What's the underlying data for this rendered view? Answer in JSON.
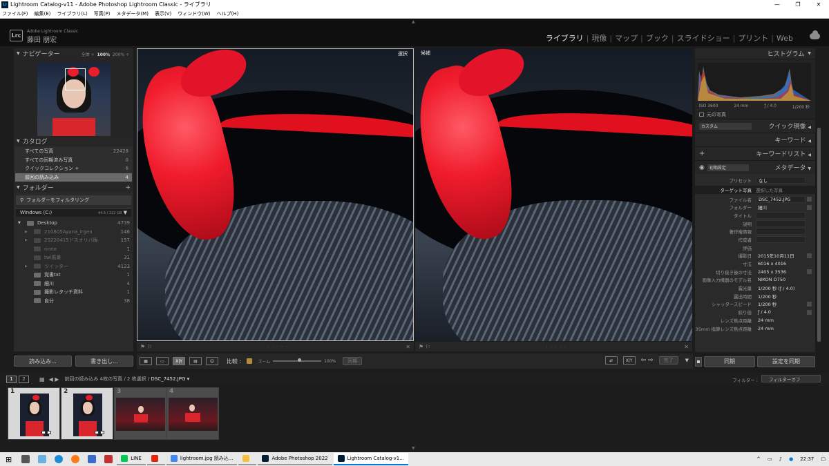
{
  "window": {
    "app_badge": "Lr",
    "title": "Lightroom Catalog-v11 - Adobe Photoshop Lightroom Classic - ライブラリ",
    "controls": [
      "—",
      "❐",
      "✕"
    ]
  },
  "menu": [
    "ファイル(F)",
    "編集(E)",
    "ライブラリ(L)",
    "写真(P)",
    "メタデータ(M)",
    "表示(V)",
    "ウィンドウ(W)",
    "ヘルプ(H)"
  ],
  "identity": {
    "logo": "Lrc",
    "product": "Adobe Lightroom Classic",
    "name": "藤田 朋宏"
  },
  "modules": {
    "items": [
      "ライブラリ",
      "現像",
      "マップ",
      "ブック",
      "スライドショー",
      "プリント",
      "Web"
    ],
    "active": "ライブラリ"
  },
  "navigator": {
    "title": "ナビゲーター",
    "zooms": [
      "全体 ÷",
      "100%",
      "200% ÷"
    ]
  },
  "catalog": {
    "title": "カタログ",
    "items": [
      {
        "label": "すべての写真",
        "count": "22428"
      },
      {
        "label": "すべての同期済み写真",
        "count": "0"
      },
      {
        "label": "クイックコレクション +",
        "count": "6"
      },
      {
        "label": "前回の読み込み",
        "count": "4"
      }
    ]
  },
  "folders": {
    "title": "フォルダー",
    "plus": "+",
    "filter_label": "フォルダーをフィルタリング",
    "volume": {
      "name": "Windows (C:)",
      "capacity": "44.5 / 222 GB"
    },
    "items": [
      {
        "name": "Desktop",
        "count": "4739",
        "level": 0,
        "arrow": "▼",
        "dim": false
      },
      {
        "name": "210805Ayana_Irgen",
        "count": "146",
        "level": 1,
        "arrow": "▶",
        "dim": true
      },
      {
        "name": "20220415ドスオリバ版",
        "count": "157",
        "level": 1,
        "arrow": "▶",
        "dim": true
      },
      {
        "name": "rinne",
        "count": "1",
        "level": 1,
        "arrow": "",
        "dim": true
      },
      {
        "name": "twi風景",
        "count": "31",
        "level": 1,
        "arrow": "",
        "dim": true
      },
      {
        "name": "ツイッター",
        "count": "4123",
        "level": 1,
        "arrow": "▶",
        "dim": true
      },
      {
        "name": "覚書txt",
        "count": "1",
        "level": 1,
        "arrow": "",
        "dim": false
      },
      {
        "name": "細川",
        "count": "4",
        "level": 1,
        "arrow": "",
        "dim": false
      },
      {
        "name": "撮影レタッチ資料",
        "count": "1",
        "level": 1,
        "arrow": "",
        "dim": false
      },
      {
        "name": "自分",
        "count": "38",
        "level": 1,
        "arrow": "",
        "dim": false
      }
    ]
  },
  "left_buttons": {
    "import": "読み込み...",
    "export": "書き出し..."
  },
  "compare": {
    "select_label": "選択",
    "candidate_label": "候補"
  },
  "toolbar": {
    "compare_label": "比較 :",
    "zoom_label": "ズーム",
    "zoom_value": "100%",
    "sync_label": "同期",
    "done_label": "完了",
    "xy_label": "X|Y"
  },
  "histogram": {
    "title": "ヒストグラム",
    "iso": "ISO 3600",
    "focal": "24 mm",
    "aperture": "ƒ / 4.0",
    "shutter": "1/200 秒",
    "original_label": "元の写真"
  },
  "quick_develop": {
    "preset": "カスタム",
    "title": "クイック現像"
  },
  "keywords": {
    "title": "キーワード"
  },
  "keyword_list": {
    "title": "キーワードリスト",
    "plus": "+"
  },
  "metadata": {
    "title": "メタデータ",
    "preset_select": "初期設定",
    "preset_label": "プリセット",
    "preset_value": "なし",
    "target_key": "ターゲット写真",
    "target_value": "選択した写真",
    "rows": [
      {
        "key": "ファイル名",
        "value": "DSC_7452.JPG",
        "box": true,
        "edit": true
      },
      {
        "key": "フォルダー",
        "value": "細川",
        "box": false,
        "edit": true
      },
      {
        "key": "タイトル",
        "value": "",
        "box": true,
        "edit": false
      },
      {
        "key": "説明",
        "value": "",
        "box": true,
        "edit": false
      },
      {
        "key": "著作権情報",
        "value": "",
        "box": true,
        "edit": false
      },
      {
        "key": "作成者",
        "value": "",
        "box": true,
        "edit": false
      },
      {
        "key": "評価",
        "value": "",
        "box": false,
        "edit": false
      },
      {
        "key": "撮影日",
        "value": "2015年10月11日",
        "box": false,
        "edit": true
      },
      {
        "key": "寸法",
        "value": "6016 x 4016",
        "box": false,
        "edit": false
      },
      {
        "key": "切り抜き後の寸法",
        "value": "2405 x 3536",
        "box": false,
        "edit": true
      },
      {
        "key": "画像入力機器のモデル名",
        "value": "NIKON D750",
        "box": false,
        "edit": false
      },
      {
        "key": "露光量",
        "value": "1/200 秒 (ƒ / 4.0)",
        "box": false,
        "edit": false
      },
      {
        "key": "露出時間",
        "value": "1/200 秒",
        "box": false,
        "edit": false
      },
      {
        "key": "シャッタースピード",
        "value": "1/200 秒",
        "box": false,
        "edit": true
      },
      {
        "key": "絞り値",
        "value": "ƒ / 4.0",
        "box": false,
        "edit": true
      },
      {
        "key": "レンズ焦点距離",
        "value": "24 mm",
        "box": false,
        "edit": false
      },
      {
        "key": "35mm 換算レンズ焦点距離",
        "value": "24 mm",
        "box": false,
        "edit": false
      }
    ]
  },
  "right_buttons": {
    "sync": "同期",
    "sync_settings": "設定を同期"
  },
  "filmstrip_bar": {
    "screen1": "1",
    "screen2": "2",
    "source_prefix": "前回の読み込み  4枚の写真 / 2 枚選択 /",
    "source_file": "DSC_7452.JPG ▾",
    "filter_label": "フィルター :",
    "filter_value": "フィルターオフ"
  },
  "filmstrip": [
    {
      "num": "1",
      "state": "sel"
    },
    {
      "num": "2",
      "state": "sel"
    },
    {
      "num": "3",
      "state": "dim"
    },
    {
      "num": "4",
      "state": "dim"
    }
  ],
  "taskbar": {
    "apps": [
      {
        "label": "LINE",
        "color": "#06c755",
        "active": false
      },
      {
        "label": "",
        "color": "#e8260e",
        "active": false
      },
      {
        "label": "lightroom.jpg 読み込...",
        "color": "#4285f4",
        "active": false
      },
      {
        "label": "",
        "color": "#f6c143",
        "active": false
      },
      {
        "label": "Adobe Photoshop 2022",
        "color": "#001e36",
        "active": false
      },
      {
        "label": "Lightroom Catalog-v1...",
        "color": "#001e36",
        "active": true
      }
    ],
    "time": "22:37",
    "tray_arrow": "^"
  },
  "colors": {
    "accent": "#0078d7",
    "photo_red": "#e8141e",
    "panel": "#2a2a2a"
  }
}
